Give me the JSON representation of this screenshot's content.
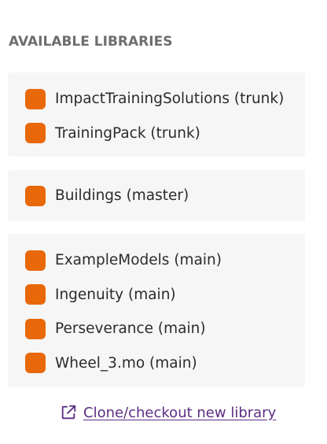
{
  "section_title": "AVAILABLE LIBRARIES",
  "colors": {
    "library_swatch": "#e8680a",
    "link": "#5b2d82",
    "group_background": "#f6f6f6",
    "title_text": "#6e6e6e"
  },
  "library_groups": [
    {
      "items": [
        {
          "label": "ImpactTrainingSolutions (trunk)",
          "icon": "library-swatch"
        },
        {
          "label": "TrainingPack (trunk)",
          "icon": "library-swatch"
        }
      ]
    },
    {
      "items": [
        {
          "label": "Buildings (master)",
          "icon": "library-swatch"
        }
      ]
    },
    {
      "items": [
        {
          "label": "ExampleModels (main)",
          "icon": "library-swatch"
        },
        {
          "label": "Ingenuity (main)",
          "icon": "library-swatch"
        },
        {
          "label": "Perseverance (main)",
          "icon": "library-swatch"
        },
        {
          "label": "Wheel_3.mo (main)",
          "icon": "library-swatch"
        }
      ]
    }
  ],
  "clone_link": {
    "label": "Clone/checkout new library",
    "icon": "external-link-icon"
  }
}
